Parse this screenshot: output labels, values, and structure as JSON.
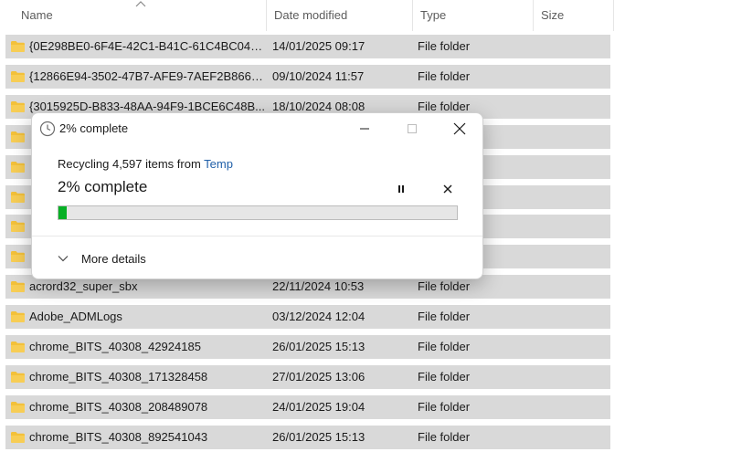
{
  "columns": {
    "name": "Name",
    "date": "Date modified",
    "type": "Type",
    "size": "Size"
  },
  "rows": [
    {
      "name": "{0E298BE0-6F4E-42C1-B41C-61C4BC043...",
      "date": "14/01/2025 09:17",
      "type": "File folder"
    },
    {
      "name": "{12866E94-3502-47B7-AFE9-7AEF2B8667...",
      "date": "09/10/2024 11:57",
      "type": "File folder"
    },
    {
      "name": "{3015925D-B833-48AA-94F9-1BCE6C48B...",
      "date": "18/10/2024 08:08",
      "type": "File folder"
    },
    {
      "name": "",
      "date": "",
      "type": ""
    },
    {
      "name": "",
      "date": "",
      "type": ""
    },
    {
      "name": "",
      "date": "",
      "type": ""
    },
    {
      "name": "",
      "date": "",
      "type": ""
    },
    {
      "name": "",
      "date": "",
      "type": ""
    },
    {
      "name": "acrord32_super_sbx",
      "date": "22/11/2024 10:53",
      "type": "File folder"
    },
    {
      "name": "Adobe_ADMLogs",
      "date": "03/12/2024 12:04",
      "type": "File folder"
    },
    {
      "name": "chrome_BITS_40308_42924185",
      "date": "26/01/2025 15:13",
      "type": "File folder"
    },
    {
      "name": "chrome_BITS_40308_171328458",
      "date": "27/01/2025 13:06",
      "type": "File folder"
    },
    {
      "name": "chrome_BITS_40308_208489078",
      "date": "24/01/2025 19:04",
      "type": "File folder"
    },
    {
      "name": "chrome_BITS_40308_892541043",
      "date": "26/01/2025 15:13",
      "type": "File folder"
    }
  ],
  "dialog": {
    "title": "2% complete",
    "status_prefix": "Recycling 4,597 items from ",
    "status_location": "Temp",
    "big_status": "2% complete",
    "progress_fraction": 0.02,
    "more_details": "More details"
  },
  "colors": {
    "row_bg": "#d9d9d9",
    "folder": "#f3c13a",
    "link": "#1f5fa8",
    "progress": "#06b025"
  }
}
